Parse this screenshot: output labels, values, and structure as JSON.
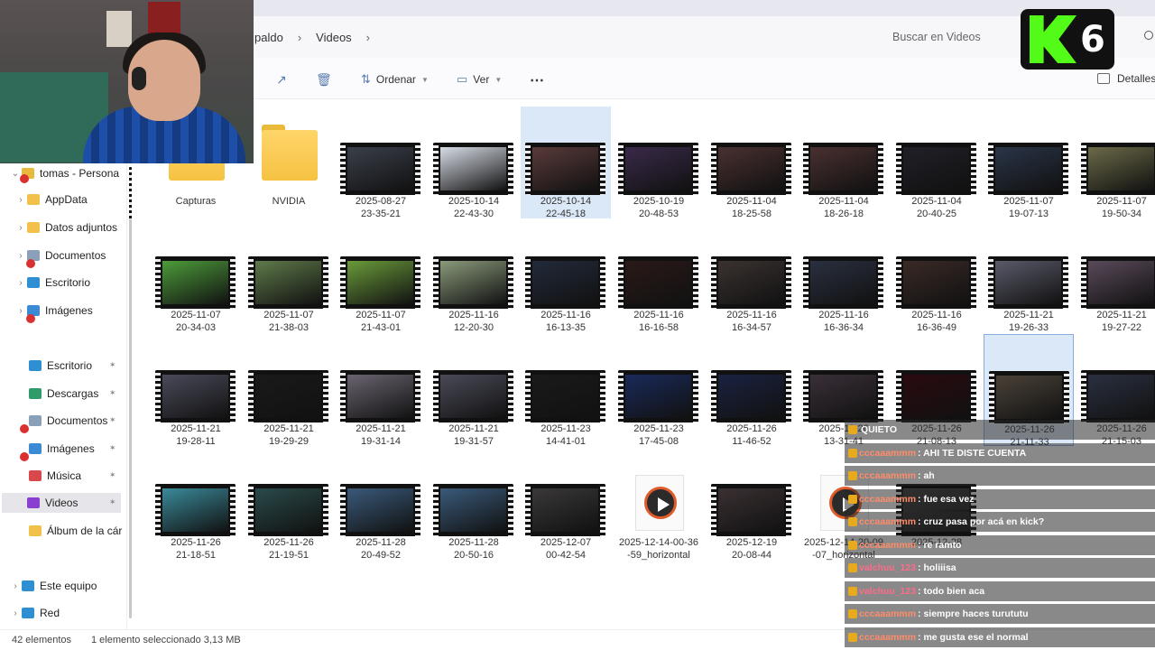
{
  "breadcrumb": [
    "paldo",
    "Videos"
  ],
  "search": {
    "placeholder": "Buscar en Videos"
  },
  "toolbar": {
    "sort_label": "Ordenar",
    "view_label": "Ver",
    "details_label": "Detalles"
  },
  "logo": {
    "number": "6"
  },
  "sidebar": {
    "items": [
      {
        "label": "tomas - Persona",
        "icon": "user-folder-icon",
        "color": "#e8b93d"
      },
      {
        "label": "AppData",
        "icon": "folder-icon",
        "color": "#f2c14a"
      },
      {
        "label": "Datos adjuntos",
        "icon": "folder-icon",
        "color": "#f2c14a"
      },
      {
        "label": "Documentos",
        "icon": "document-icon",
        "color": "#8aa0b8"
      },
      {
        "label": "Escritorio",
        "icon": "desktop-icon",
        "color": "#2f8fd3"
      },
      {
        "label": "Imágenes",
        "icon": "pictures-icon",
        "color": "#3a8ad6"
      },
      {
        "label": "Escritorio",
        "icon": "desktop-icon",
        "color": "#2f8fd3"
      },
      {
        "label": "Descargas",
        "icon": "download-icon",
        "color": "#2f9a6a"
      },
      {
        "label": "Documentos",
        "icon": "document-icon",
        "color": "#8aa0b8"
      },
      {
        "label": "Imágenes",
        "icon": "pictures-icon",
        "color": "#3a8ad6"
      },
      {
        "label": "Música",
        "icon": "music-icon",
        "color": "#d9494c"
      },
      {
        "label": "Videos",
        "icon": "video-icon",
        "color": "#8b3fd1"
      },
      {
        "label": "Álbum de la cár",
        "icon": "folder-icon",
        "color": "#f2c14a"
      },
      {
        "label": "Este equipo",
        "icon": "computer-icon",
        "color": "#2f8fd3"
      },
      {
        "label": "Red",
        "icon": "network-icon",
        "color": "#2f8fd3"
      }
    ]
  },
  "files": [
    {
      "l1": "Capturas",
      "l2": "",
      "kind": "folder"
    },
    {
      "l1": "NVIDIA",
      "l2": "",
      "kind": "folder"
    },
    {
      "l1": "2025-08-27",
      "l2": "23-35-21",
      "kind": "video",
      "tint": "#3a3f4a"
    },
    {
      "l1": "2025-10-14",
      "l2": "22-43-30",
      "kind": "video",
      "tint": "#d8dde6"
    },
    {
      "l1": "2025-10-14",
      "l2": "22-45-18",
      "kind": "video",
      "tint": "#5a3a3a"
    },
    {
      "l1": "2025-10-19",
      "l2": "20-48-53",
      "kind": "video",
      "tint": "#3a2a4a"
    },
    {
      "l1": "2025-11-04",
      "l2": "18-25-58",
      "kind": "video",
      "tint": "#4a3030"
    },
    {
      "l1": "2025-11-04",
      "l2": "18-26-18",
      "kind": "video",
      "tint": "#4a3030"
    },
    {
      "l1": "2025-11-04",
      "l2": "20-40-25",
      "kind": "video",
      "tint": "#202028"
    },
    {
      "l1": "2025-11-07",
      "l2": "19-07-13",
      "kind": "video",
      "tint": "#2a3548"
    },
    {
      "l1": "2025-11-07",
      "l2": "19-50-34",
      "kind": "video",
      "tint": "#6b6a48"
    },
    {
      "l1": "2025-11-07",
      "l2": "20-34-03",
      "kind": "video",
      "tint": "#4d9b3a"
    },
    {
      "l1": "2025-11-07",
      "l2": "21-38-03",
      "kind": "video",
      "tint": "#5f7a4a"
    },
    {
      "l1": "2025-11-07",
      "l2": "21-43-01",
      "kind": "video",
      "tint": "#6a9a3a"
    },
    {
      "l1": "2025-11-16",
      "l2": "12-20-30",
      "kind": "video",
      "tint": "#8a9a7a"
    },
    {
      "l1": "2025-11-16",
      "l2": "16-13-35",
      "kind": "video",
      "tint": "#222a3a"
    },
    {
      "l1": "2025-11-16",
      "l2": "16-16-58",
      "kind": "video",
      "tint": "#2a1a18"
    },
    {
      "l1": "2025-11-16",
      "l2": "16-34-57",
      "kind": "video",
      "tint": "#3a3230"
    },
    {
      "l1": "2025-11-16",
      "l2": "16-36-34",
      "kind": "video",
      "tint": "#2a3040"
    },
    {
      "l1": "2025-11-16",
      "l2": "16-36-49",
      "kind": "video",
      "tint": "#3a2a26"
    },
    {
      "l1": "2025-11-21",
      "l2": "19-26-33",
      "kind": "video",
      "tint": "#5a5a6a"
    },
    {
      "l1": "2025-11-21",
      "l2": "19-27-22",
      "kind": "video",
      "tint": "#5a4a5a"
    },
    {
      "l1": "2025-11-21",
      "l2": "19-28-11",
      "kind": "video",
      "tint": "#4a4a5a"
    },
    {
      "l1": "2025-11-21",
      "l2": "19-29-29",
      "kind": "video",
      "tint": "#1a1a1a"
    },
    {
      "l1": "2025-11-21",
      "l2": "19-31-14",
      "kind": "video",
      "tint": "#6a6470"
    },
    {
      "l1": "2025-11-21",
      "l2": "19-31-57",
      "kind": "video",
      "tint": "#4a4a58"
    },
    {
      "l1": "2025-11-23",
      "l2": "14-41-01",
      "kind": "video",
      "tint": "#1a1a1a"
    },
    {
      "l1": "2025-11-23",
      "l2": "17-45-08",
      "kind": "video",
      "tint": "#1a2a5a"
    },
    {
      "l1": "2025-11-26",
      "l2": "11-46-52",
      "kind": "video",
      "tint": "#1a2240"
    },
    {
      "l1": "2025-11-26",
      "l2": "13-31-41",
      "kind": "video",
      "tint": "#3a3038"
    },
    {
      "l1": "2025-11-26",
      "l2": "21-08-13",
      "kind": "video",
      "tint": "#2a0a10"
    },
    {
      "l1": "2025-11-26",
      "l2": "21-11-33",
      "kind": "video",
      "tint": "#4a4238"
    },
    {
      "l1": "2025-11-26",
      "l2": "21-15-03",
      "kind": "video",
      "tint": "#2a3040"
    },
    {
      "l1": "2025-11-26",
      "l2": "21-18-51",
      "kind": "video",
      "tint": "#3a8a9a"
    },
    {
      "l1": "2025-11-26",
      "l2": "21-19-51",
      "kind": "video",
      "tint": "#2a4a4a"
    },
    {
      "l1": "2025-11-28",
      "l2": "20-49-52",
      "kind": "video",
      "tint": "#3a5a7a"
    },
    {
      "l1": "2025-11-28",
      "l2": "20-50-16",
      "kind": "video",
      "tint": "#3a5a7a"
    },
    {
      "l1": "2025-12-07",
      "l2": "00-42-54",
      "kind": "video",
      "tint": "#3a3838"
    },
    {
      "l1": "2025-12-14-00-36",
      "l2": "-59_horizontal",
      "kind": "media"
    },
    {
      "l1": "2025-12-19",
      "l2": "20-08-44",
      "kind": "video",
      "tint": "#3a3032"
    },
    {
      "l1": "2025-12-14-20-09",
      "l2": "-07_horizontal",
      "kind": "media"
    },
    {
      "l1": "2025-12-28",
      "l2": "",
      "kind": "video",
      "tint": "#3a3838"
    }
  ],
  "status": {
    "count": "42 elementos",
    "selection": "1 elemento seleccionado  3,13 MB"
  },
  "chat": [
    {
      "user": "",
      "msg": "QUIETO"
    },
    {
      "user": "cccaaammm",
      "msg": ": AHI TE DISTE CUENTA"
    },
    {
      "user": "cccaaammm",
      "msg": ": ah"
    },
    {
      "user": "cccaaammm",
      "msg": ": fue esa vez"
    },
    {
      "user": "cccaaammm",
      "msg": ": cruz pasa por acá en kick?"
    },
    {
      "user": "cccaaammm",
      "msg": ": re ramto"
    },
    {
      "user": "valchuu_123",
      "msg": ": holiiisa"
    },
    {
      "user": "valchuu_123",
      "msg": ": todo bien aca"
    },
    {
      "user": "cccaaammm",
      "msg": ": siempre haces turututu"
    },
    {
      "user": "cccaaammm",
      "msg": ": me gusta ese el normal"
    }
  ]
}
